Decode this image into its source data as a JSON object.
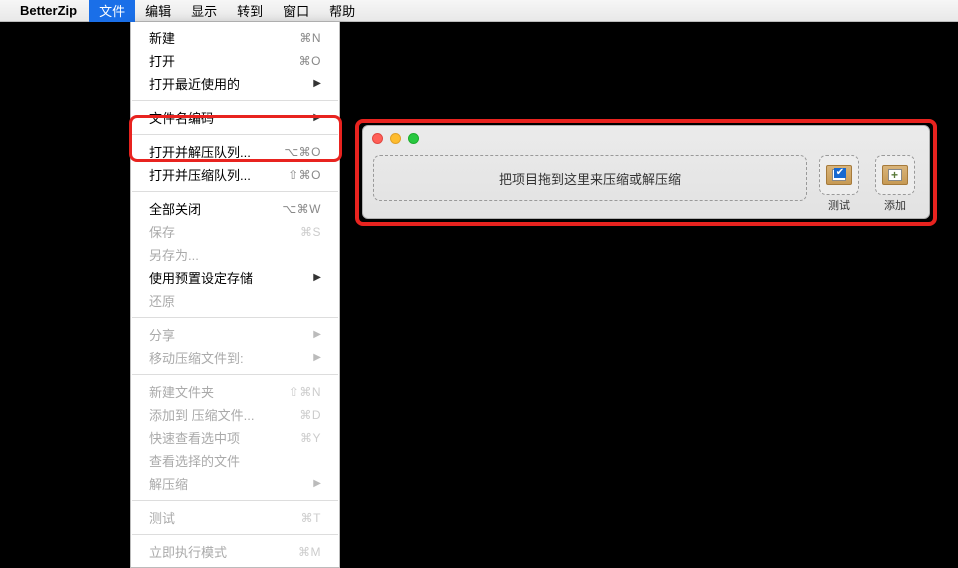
{
  "menubar": {
    "app": "BetterZip",
    "items": [
      "文件",
      "编辑",
      "显示",
      "转到",
      "窗口",
      "帮助"
    ]
  },
  "dropdown": {
    "g1": [
      {
        "label": "新建",
        "sc": "⌘N"
      },
      {
        "label": "打开",
        "sc": "⌘O"
      },
      {
        "label": "打开最近使用的",
        "arrow": true
      }
    ],
    "g2": [
      {
        "label": "文件名编码",
        "arrow": true
      }
    ],
    "g3": [
      {
        "label": "打开并解压队列...",
        "sc": "⌥⌘O"
      },
      {
        "label": "打开并压缩队列...",
        "sc": "⇧⌘O"
      }
    ],
    "g4": [
      {
        "label": "全部关闭",
        "sc": "⌥⌘W"
      },
      {
        "label": "保存",
        "sc": "⌘S",
        "disabled": true
      },
      {
        "label": "另存为...",
        "sc": "",
        "disabled": true
      },
      {
        "label": "使用预置设定存储",
        "arrow": true
      },
      {
        "label": "还原",
        "disabled": true
      }
    ],
    "g5": [
      {
        "label": "分享",
        "arrow": true,
        "disabled": true
      },
      {
        "label": "移动压缩文件到:",
        "arrow": true,
        "disabled": true
      }
    ],
    "g6": [
      {
        "label": "新建文件夹",
        "sc": "⇧⌘N",
        "disabled": true
      },
      {
        "label": "添加到 压缩文件...",
        "sc": "⌘D",
        "disabled": true
      },
      {
        "label": "快速查看选中项",
        "sc": "⌘Y",
        "disabled": true
      },
      {
        "label": "查看选择的文件",
        "sc": "",
        "disabled": true
      },
      {
        "label": "解压缩",
        "arrow": true,
        "disabled": true
      }
    ],
    "g7": [
      {
        "label": "测试",
        "sc": "⌘T",
        "disabled": true
      }
    ],
    "g8": [
      {
        "label": "立即执行模式",
        "sc": "⌘M",
        "disabled": true
      }
    ]
  },
  "window": {
    "dropzone": "把项目拖到这里来压缩或解压缩",
    "test": "测试",
    "add": "添加"
  }
}
